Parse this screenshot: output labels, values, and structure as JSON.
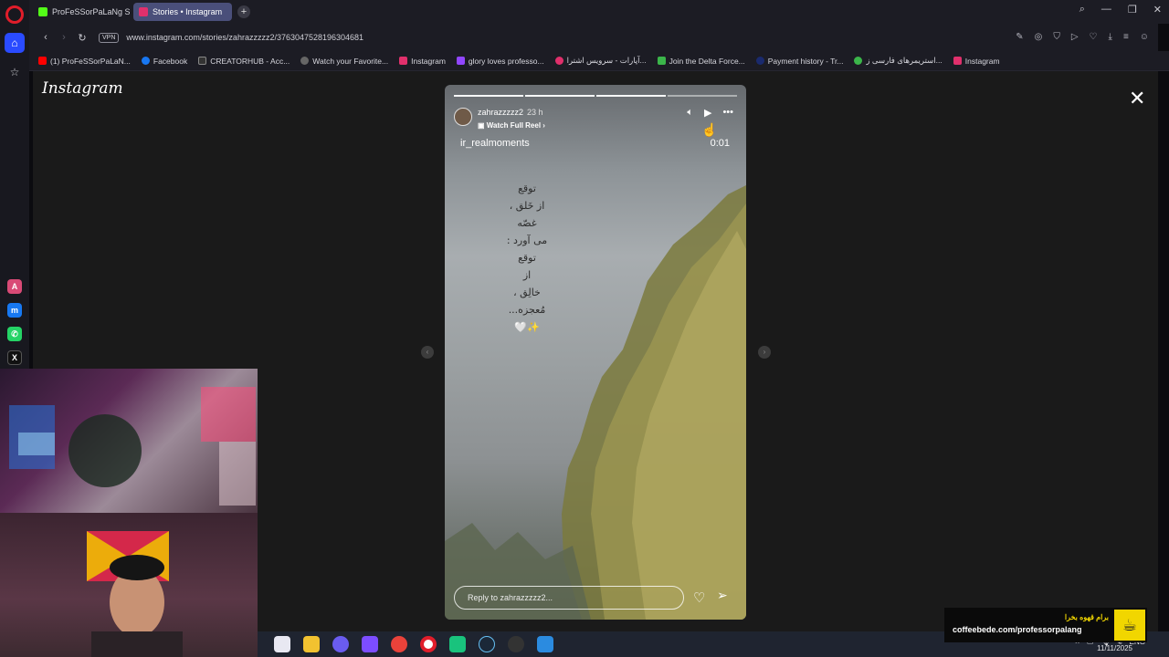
{
  "browser": {
    "tabs": [
      {
        "label": "ProFeSSorPaLaNg Stream",
        "active": false,
        "color": "#53fc18"
      },
      {
        "label": "Stories • Instagram",
        "active": true,
        "color": "#e1306c"
      }
    ],
    "url": "www.instagram.com/stories/zahrazzzzz2/3763047528196304681",
    "vpn_label": "VPN",
    "bookmarks": [
      "(1) ProFeSSorPaLaN...",
      "Facebook",
      "CREATORHUB - Acc...",
      "Watch your Favorite...",
      "Instagram",
      "glory loves professo...",
      "آپارات - سرویس اشترا...",
      "Join the Delta Force...",
      "Payment history - Tr...",
      "استریمرهای فارسی ز...",
      "Instagram"
    ]
  },
  "instagram": {
    "logo": "Instagram",
    "story": {
      "username": "zahrazzzzz2",
      "time": "23 h",
      "watch_full_reel": "Watch Full Reel",
      "music_user": "ir_realmoments",
      "music_time": "0:01",
      "poem_lines": [
        "توقع",
        "از خَلق ،",
        "غصّه",
        "می آورد :",
        "توقع",
        "از",
        "خالِق ،",
        "مُعجزه...",
        "✨🤍"
      ],
      "reply_placeholder": "Reply to zahrazzzzz2...",
      "progress_segments": 4
    }
  },
  "overlay": {
    "banner_text_fa": "برام قهوه بخرا",
    "banner_url": "coffeebede.com/professorpalang"
  },
  "taskbar": {
    "lang": "ENG",
    "date": "11/11/2025"
  }
}
